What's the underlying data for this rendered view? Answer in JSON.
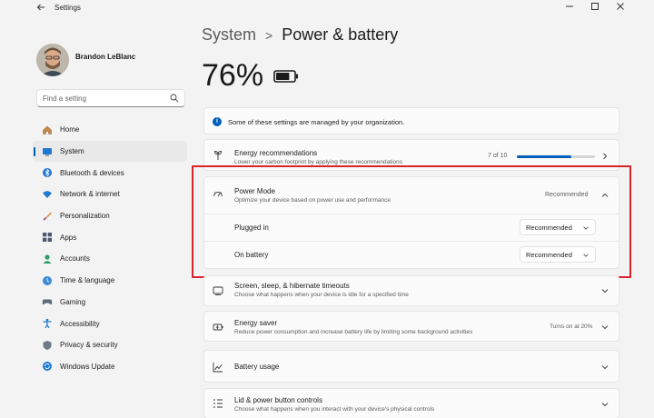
{
  "window": {
    "title": "Settings",
    "back_icon": "arrow-left-icon",
    "controls": [
      "minimize-icon",
      "maximize-icon",
      "close-icon"
    ]
  },
  "user": {
    "name": "Brandon LeBlanc"
  },
  "search": {
    "placeholder": "Find a setting"
  },
  "nav": {
    "items": [
      {
        "label": "Home",
        "icon": "home-icon",
        "active": false
      },
      {
        "label": "System",
        "icon": "system-icon",
        "active": true
      },
      {
        "label": "Bluetooth & devices",
        "icon": "bluetooth-icon",
        "active": false
      },
      {
        "label": "Network & internet",
        "icon": "wifi-icon",
        "active": false
      },
      {
        "label": "Personalization",
        "icon": "brush-icon",
        "active": false
      },
      {
        "label": "Apps",
        "icon": "apps-icon",
        "active": false
      },
      {
        "label": "Accounts",
        "icon": "accounts-icon",
        "active": false
      },
      {
        "label": "Time & language",
        "icon": "globe-clock-icon",
        "active": false
      },
      {
        "label": "Gaming",
        "icon": "gamepad-icon",
        "active": false
      },
      {
        "label": "Accessibility",
        "icon": "accessibility-icon",
        "active": false
      },
      {
        "label": "Privacy & security",
        "icon": "shield-icon",
        "active": false
      },
      {
        "label": "Windows Update",
        "icon": "update-icon",
        "active": false
      }
    ]
  },
  "breadcrumb": {
    "parent": "System",
    "separator": ">",
    "current": "Power & battery"
  },
  "battery": {
    "percent_text": "76%",
    "level": 0.76
  },
  "info": {
    "text": "Some of these settings are managed by your organization."
  },
  "energy": {
    "title": "Energy recommendations",
    "subtitle": "Lower your carbon footprint by applying these recommendations",
    "progress_text": "7 of 10",
    "progress": 0.7
  },
  "power_mode": {
    "title": "Power Mode",
    "subtitle": "Optimize your device based on power use and performance",
    "value": "Recommended",
    "plugged_in_label": "Plugged in",
    "plugged_in_value": "Recommended",
    "on_battery_label": "On battery",
    "on_battery_value": "Recommended"
  },
  "screen_sleep": {
    "title": "Screen, sleep, & hibernate timeouts",
    "subtitle": "Choose what happens when your device is idle for a specified time"
  },
  "energy_saver": {
    "title": "Energy saver",
    "subtitle": "Reduce power consumption and increase battery life by limiting some background activities",
    "status": "Turns on at 20%"
  },
  "battery_usage": {
    "title": "Battery usage"
  },
  "lid": {
    "title": "Lid & power button controls",
    "subtitle": "Choose what happens when you interact with your device's physical controls"
  },
  "colors": {
    "accent": "#005fb8",
    "highlight": "#d9232a"
  }
}
